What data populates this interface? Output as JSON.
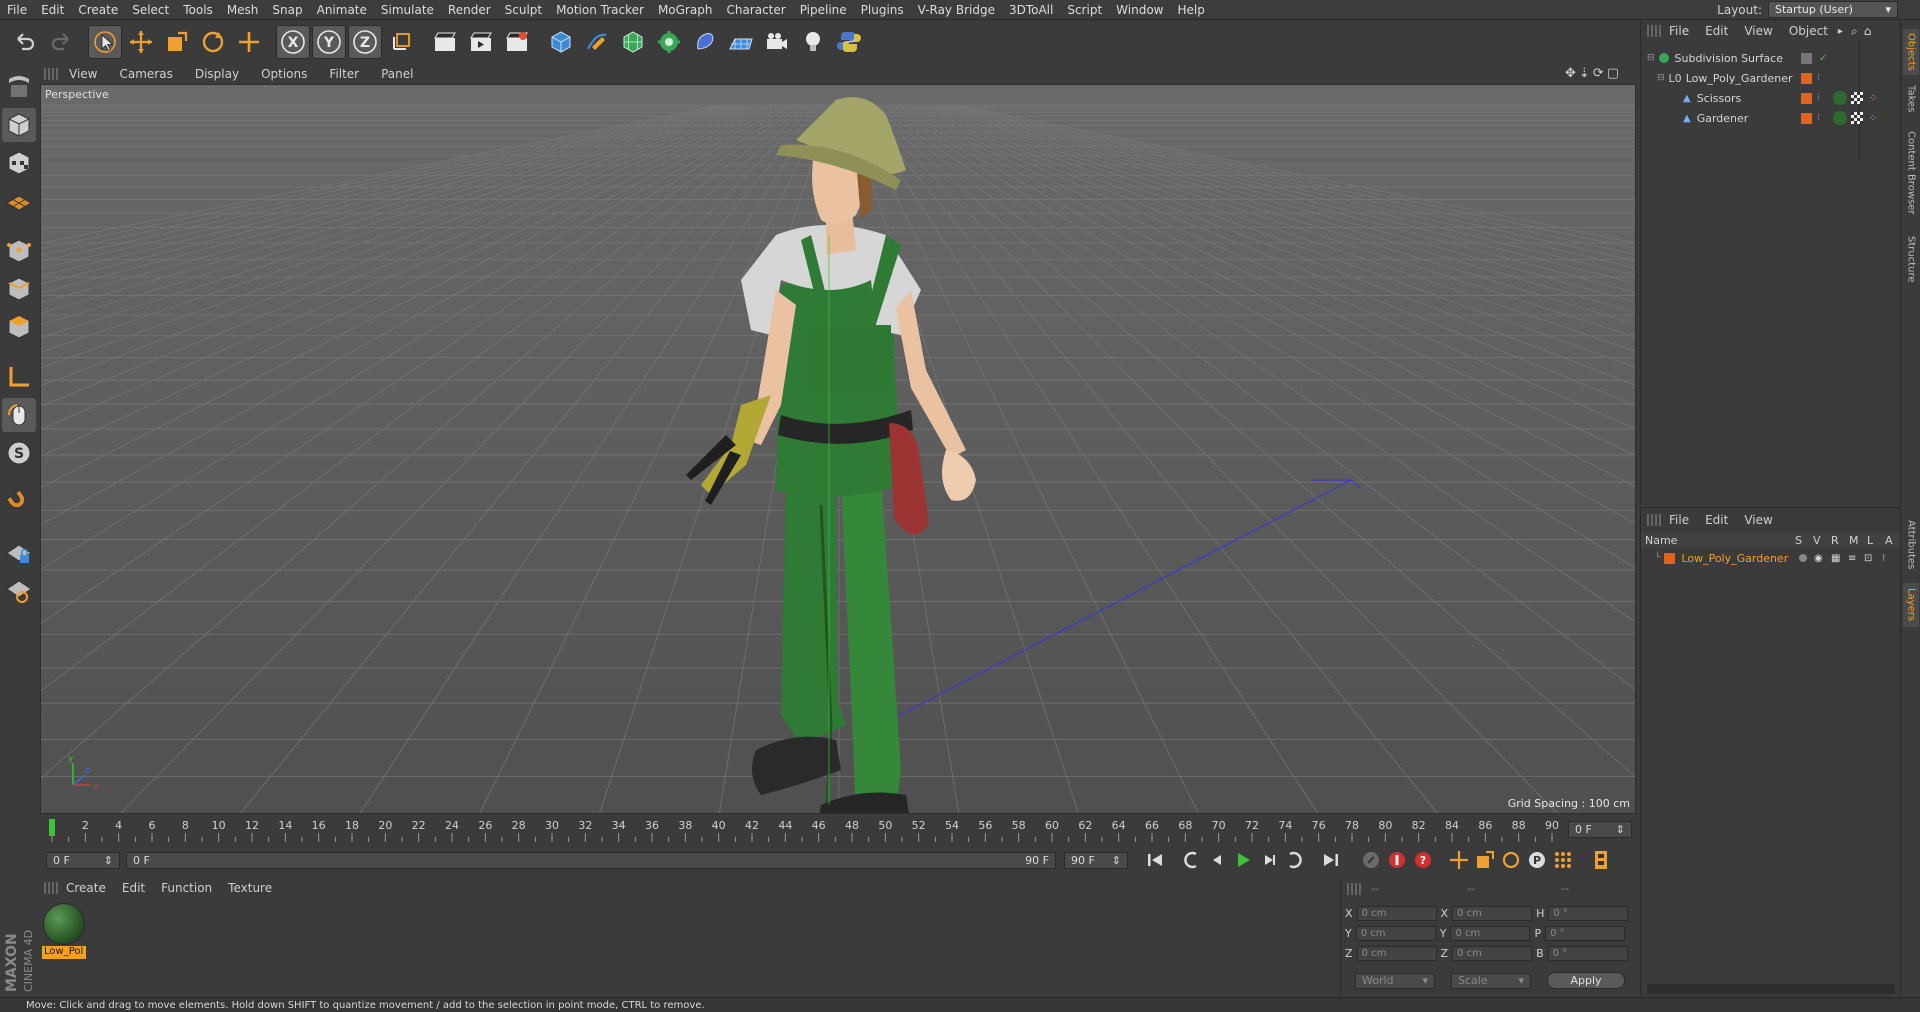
{
  "menubar": {
    "items": [
      "File",
      "Edit",
      "Create",
      "Select",
      "Tools",
      "Mesh",
      "Snap",
      "Animate",
      "Simulate",
      "Render",
      "Sculpt",
      "Motion Tracker",
      "MoGraph",
      "Character",
      "Pipeline",
      "Plugins",
      "V-Ray Bridge",
      "3DToAll",
      "Script",
      "Window",
      "Help"
    ],
    "layout_label": "Layout:",
    "layout_value": "Startup (User)"
  },
  "toolbar": {
    "axis_x": "X",
    "axis_y": "Y",
    "axis_z": "Z"
  },
  "viewport": {
    "menu": [
      "View",
      "Cameras",
      "Display",
      "Options",
      "Filter",
      "Panel"
    ],
    "label": "Perspective",
    "grid_spacing": "Grid Spacing : 100 cm",
    "axis_y": "y",
    "axis_x": "x",
    "axis_z": "z"
  },
  "timeline": {
    "ticks": [
      "0",
      "2",
      "4",
      "6",
      "8",
      "10",
      "12",
      "14",
      "16",
      "18",
      "20",
      "22",
      "24",
      "26",
      "28",
      "30",
      "32",
      "34",
      "36",
      "38",
      "40",
      "42",
      "44",
      "46",
      "48",
      "50",
      "52",
      "54",
      "56",
      "58",
      "60",
      "62",
      "64",
      "66",
      "68",
      "70",
      "72",
      "74",
      "76",
      "78",
      "80",
      "82",
      "84",
      "86",
      "88",
      "90"
    ],
    "current_frame": "0 F",
    "start_field": "0 F",
    "range_start": "0 F",
    "range_end": "90 F",
    "end_field": "90 F"
  },
  "material": {
    "menu": [
      "Create",
      "Edit",
      "Function",
      "Texture"
    ],
    "items": [
      {
        "name": "Low_Pol"
      }
    ]
  },
  "coords": {
    "header_a": "--",
    "header_b": "--",
    "header_c": "--",
    "rows": [
      {
        "a": "X",
        "av": "0 cm",
        "b": "X",
        "bv": "0 cm",
        "c": "H",
        "cv": "0 °"
      },
      {
        "a": "Y",
        "av": "0 cm",
        "b": "Y",
        "bv": "0 cm",
        "c": "P",
        "cv": "0 °"
      },
      {
        "a": "Z",
        "av": "0 cm",
        "b": "Z",
        "bv": "0 cm",
        "c": "B",
        "cv": "0 °"
      }
    ],
    "world": "World",
    "scale": "Scale",
    "apply": "Apply"
  },
  "objects": {
    "menu": [
      "File",
      "Edit",
      "View",
      "Object"
    ],
    "tree": [
      {
        "name": "Subdivision Surface",
        "indent": 0
      },
      {
        "name": "Low_Poly_Gardener",
        "indent": 1
      },
      {
        "name": "Scissors",
        "indent": 2
      },
      {
        "name": "Gardener",
        "indent": 2
      }
    ]
  },
  "layers": {
    "menu": [
      "File",
      "Edit",
      "View"
    ],
    "columns": [
      "Name",
      "S",
      "V",
      "R",
      "M",
      "L",
      "A"
    ],
    "rows": [
      {
        "name": "Low_Poly_Gardener"
      }
    ]
  },
  "side_tabs": [
    "Objects",
    "Takes",
    "Content Browser",
    "Structure",
    "Attributes",
    "Layers"
  ],
  "status": "Move: Click and drag to move elements. Hold down SHIFT to quantize movement / add to the selection in point mode, CTRL to remove.",
  "brand": {
    "line1": "MAXON",
    "line2": "CINEMA 4D"
  },
  "colors": {
    "accent": "#f4a020",
    "tag": "#e0641e",
    "selected_text": "#f0a030"
  }
}
